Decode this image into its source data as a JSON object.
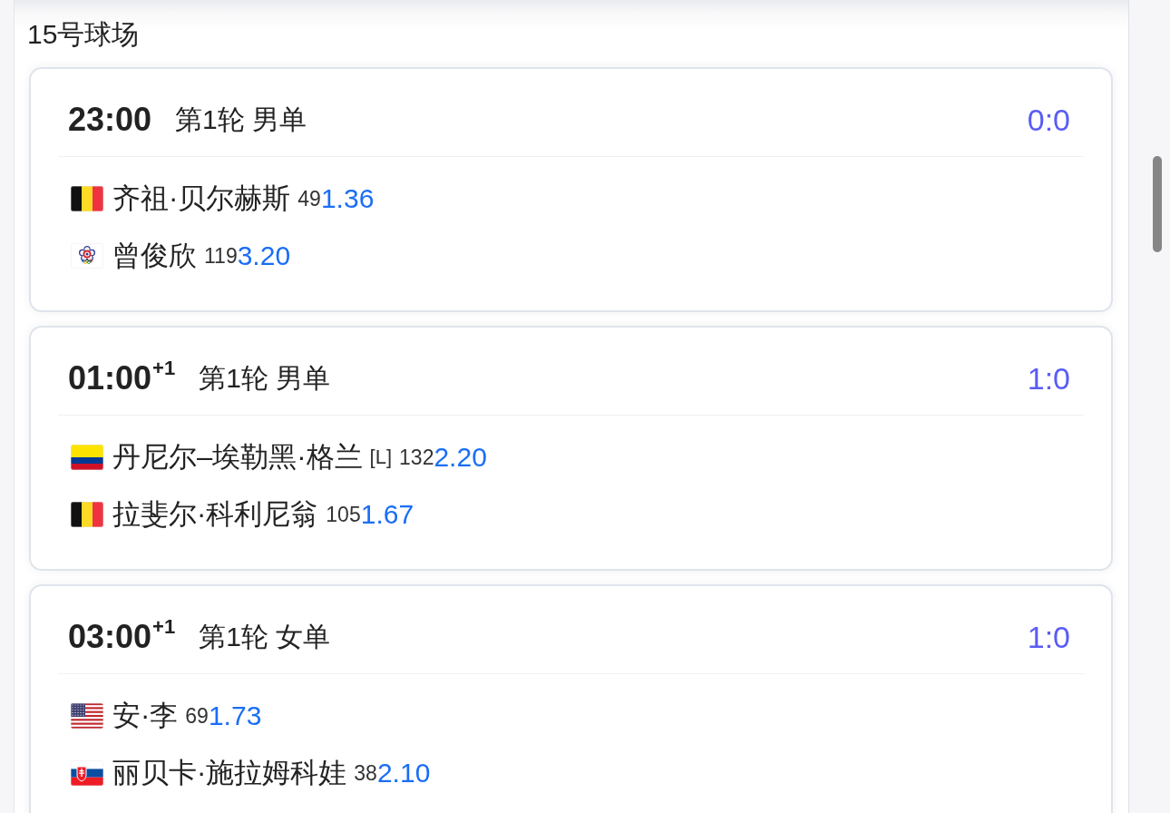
{
  "court": {
    "title": "15号球场"
  },
  "matches": [
    {
      "time": "23:00",
      "round": "第1轮 男单",
      "score": "0:0",
      "players": [
        {
          "kind": "belgium",
          "name": "齐祖·贝尔赫斯",
          "rank": "49",
          "odds": "1.36"
        },
        {
          "kind": "taipei",
          "name": "曾俊欣",
          "rank": "119",
          "odds": "3.20"
        }
      ]
    },
    {
      "time": "01:00$^{+1}$",
      "round": "第1轮 男单",
      "score": "1:0",
      "players": [
        {
          "kind": "colombia",
          "name": "丹尼尔–埃勒黑·格兰",
          "entry": "[L]",
          "rank": "132",
          "odds": "2.20"
        },
        {
          "kind": "belgium",
          "name": "拉斐尔·科利尼翁",
          "rank": "105",
          "odds": "1.67"
        }
      ]
    },
    {
      "time": "03:00$^{+1}$",
      "round": "第1轮 女单",
      "score": "1:0",
      "players": [
        {
          "kind": "usa",
          "name": "安·李",
          "rank": "69",
          "odds": "1.73"
        },
        {
          "kind": "slovakia",
          "name": "丽贝卡·施拉姆科娃",
          "rank": "38",
          "odds": "2.10"
        }
      ]
    }
  ]
}
